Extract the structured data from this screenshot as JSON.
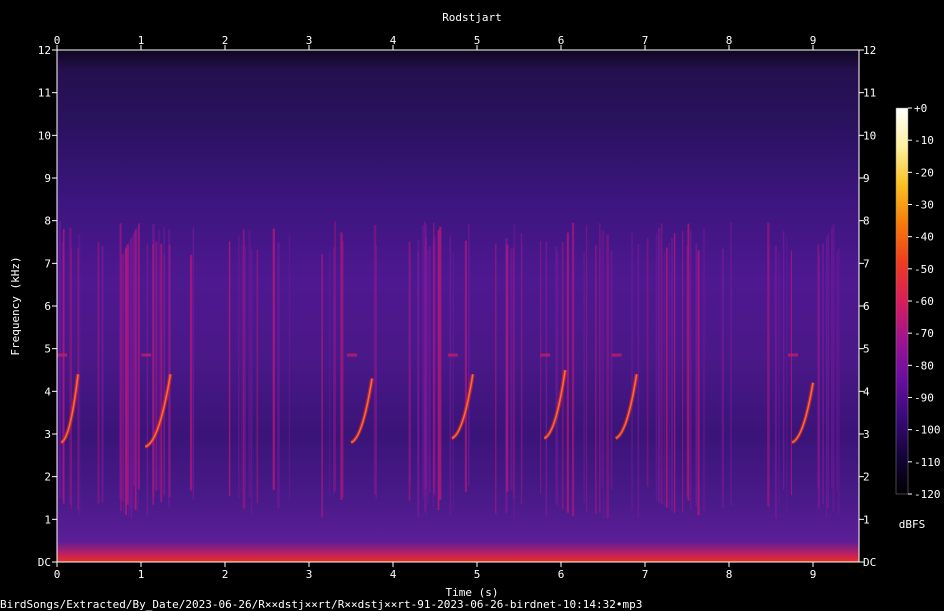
{
  "chart_data": {
    "type": "heatmap",
    "title": "Rodstjart",
    "xlabel": "Time (s)",
    "ylabel": "Frequency (kHz)",
    "xlim": [
      0,
      9.5
    ],
    "ylim": [
      0,
      12
    ],
    "x_ticks": [
      "0",
      "1",
      "2",
      "3",
      "4",
      "5",
      "6",
      "7",
      "8",
      "9"
    ],
    "y_ticks": [
      "DC",
      "1",
      "2",
      "3",
      "4",
      "5",
      "6",
      "7",
      "8",
      "9",
      "10",
      "11",
      "12"
    ],
    "colorbar": {
      "label": "dBFS",
      "range": [
        -120,
        0
      ],
      "ticks": [
        "+0",
        "-10",
        "-20",
        "-30",
        "-40",
        "-50",
        "-60",
        "-70",
        "-80",
        "-90",
        "-100",
        "-110",
        "-120"
      ],
      "colors": [
        "#000000",
        "#14043a",
        "#3a0a7a",
        "#6a0ea0",
        "#a01490",
        "#d81e5a",
        "#f03c1e",
        "#f87a0a",
        "#fcc020",
        "#fff0a0",
        "#ffffff"
      ]
    },
    "calls": [
      {
        "start_s": 0.05,
        "end_s": 0.25,
        "low_khz": 2.8,
        "high_khz": 4.4
      },
      {
        "start_s": 1.05,
        "end_s": 1.35,
        "low_khz": 2.7,
        "high_khz": 4.4
      },
      {
        "start_s": 3.5,
        "end_s": 3.75,
        "low_khz": 2.8,
        "high_khz": 4.3
      },
      {
        "start_s": 4.7,
        "end_s": 4.95,
        "low_khz": 2.9,
        "high_khz": 4.4
      },
      {
        "start_s": 5.8,
        "end_s": 6.05,
        "low_khz": 2.9,
        "high_khz": 4.5
      },
      {
        "start_s": 6.65,
        "end_s": 6.9,
        "low_khz": 2.9,
        "high_khz": 4.4
      },
      {
        "start_s": 8.75,
        "end_s": 9.0,
        "low_khz": 2.8,
        "high_khz": 4.2
      }
    ]
  },
  "footer": {
    "source_path": "BirdSongs/Extracted/By_Date/2023-06-26/R××dstj××rt/R××dstj××rt-91-2023-06-26-birdnet-10:14:32•mp3"
  }
}
